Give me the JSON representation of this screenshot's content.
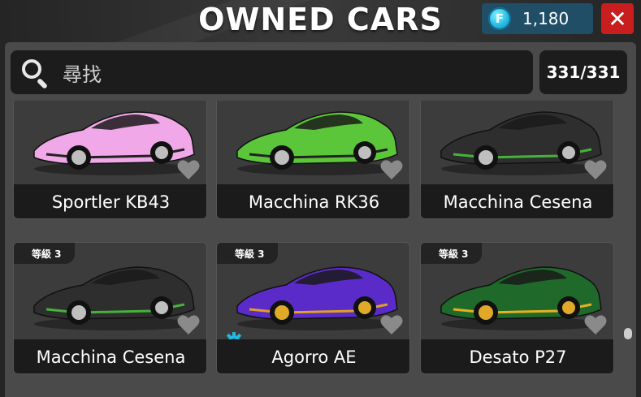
{
  "header": {
    "title": "OWNED CARS"
  },
  "currency": {
    "icon": "coin-icon",
    "value": "1,180"
  },
  "close": {
    "label": "✕"
  },
  "search": {
    "placeholder": "尋找",
    "icon": "search-icon"
  },
  "count": "331/331",
  "cars": [
    {
      "name": "Sportler KB43",
      "level": "",
      "color": "#f0a8e8",
      "accent": "#222222",
      "gear": false
    },
    {
      "name": "Macchina RK36",
      "level": "",
      "color": "#5cc63a",
      "accent": "#222222",
      "gear": false
    },
    {
      "name": "Macchina Cesena",
      "level": "",
      "color": "#2e2e2e",
      "accent": "#45b23a",
      "gear": false
    },
    {
      "name": "Macchina Cesena",
      "level": "等級 3",
      "color": "#2e2e2e",
      "accent": "#45b23a",
      "gear": false
    },
    {
      "name": "Agorro AE",
      "level": "等級 3",
      "color": "#5a2bc8",
      "accent": "#e0a020",
      "gear": true
    },
    {
      "name": "Desato P27",
      "level": "等級 3",
      "color": "#1f6a2a",
      "accent": "#e8b020",
      "gear": false
    }
  ],
  "colors": {
    "panel": "#4a4a4a",
    "close": "#c81e1e",
    "currency_bg": "#1f4e66",
    "gear": "#22b8e0"
  }
}
